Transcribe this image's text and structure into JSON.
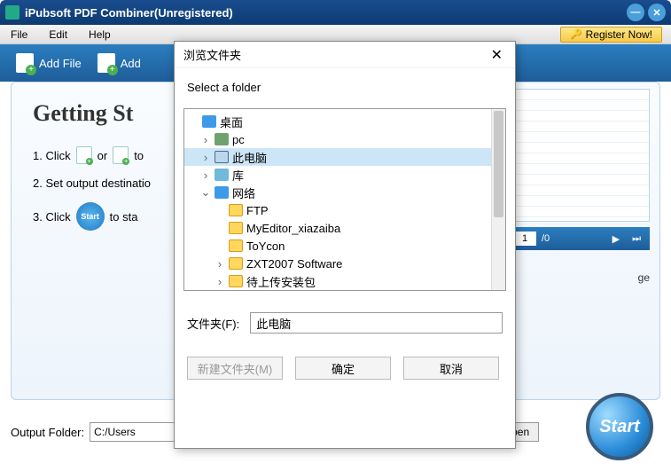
{
  "titlebar": {
    "title": "iPubsoft PDF Combiner(Unregistered)"
  },
  "menu": {
    "file": "File",
    "edit": "Edit",
    "help": "Help",
    "register": "Register Now!"
  },
  "toolbar": {
    "add_file": "Add File",
    "add": "Add"
  },
  "main": {
    "heading": "Getting St",
    "step1_a": "1. Click",
    "step1_or": "or",
    "step1_b": "to",
    "step2": "2. Set output destinatio",
    "step3_a": "3. Click",
    "step3_b": "to sta",
    "start_pill": "Start"
  },
  "nav": {
    "page": "1",
    "total": "/0"
  },
  "merge": {
    "label": "ge"
  },
  "output": {
    "label": "Output Folder:",
    "path": "C:/Users",
    "open": "pen"
  },
  "big_start": "Start",
  "dialog": {
    "title": "浏览文件夹",
    "subtitle": "Select a folder",
    "tree": [
      {
        "label": "桌面",
        "icon": "fold-blue",
        "indent": 0,
        "exp": ""
      },
      {
        "label": "pc",
        "icon": "ic-pc",
        "indent": 1,
        "exp": ">"
      },
      {
        "label": "此电脑",
        "icon": "ic-comp",
        "indent": 1,
        "exp": ">",
        "selected": true
      },
      {
        "label": "库",
        "icon": "ic-lib",
        "indent": 1,
        "exp": ">"
      },
      {
        "label": "网络",
        "icon": "ic-net",
        "indent": 1,
        "exp": "v"
      },
      {
        "label": "FTP",
        "icon": "fold-yellow",
        "indent": 2,
        "exp": ""
      },
      {
        "label": "MyEditor_xiazaiba",
        "icon": "fold-yellow",
        "indent": 2,
        "exp": ""
      },
      {
        "label": "ToYcon",
        "icon": "fold-yellow",
        "indent": 2,
        "exp": ""
      },
      {
        "label": "ZXT2007 Software",
        "icon": "fold-yellow",
        "indent": 2,
        "exp": ">"
      },
      {
        "label": "待上传安装包",
        "icon": "fold-yellow",
        "indent": 2,
        "exp": ">"
      }
    ],
    "folder_label": "文件夹(F):",
    "folder_value": "此电脑",
    "new_folder": "新建文件夹(M)",
    "ok": "确定",
    "cancel": "取消"
  }
}
